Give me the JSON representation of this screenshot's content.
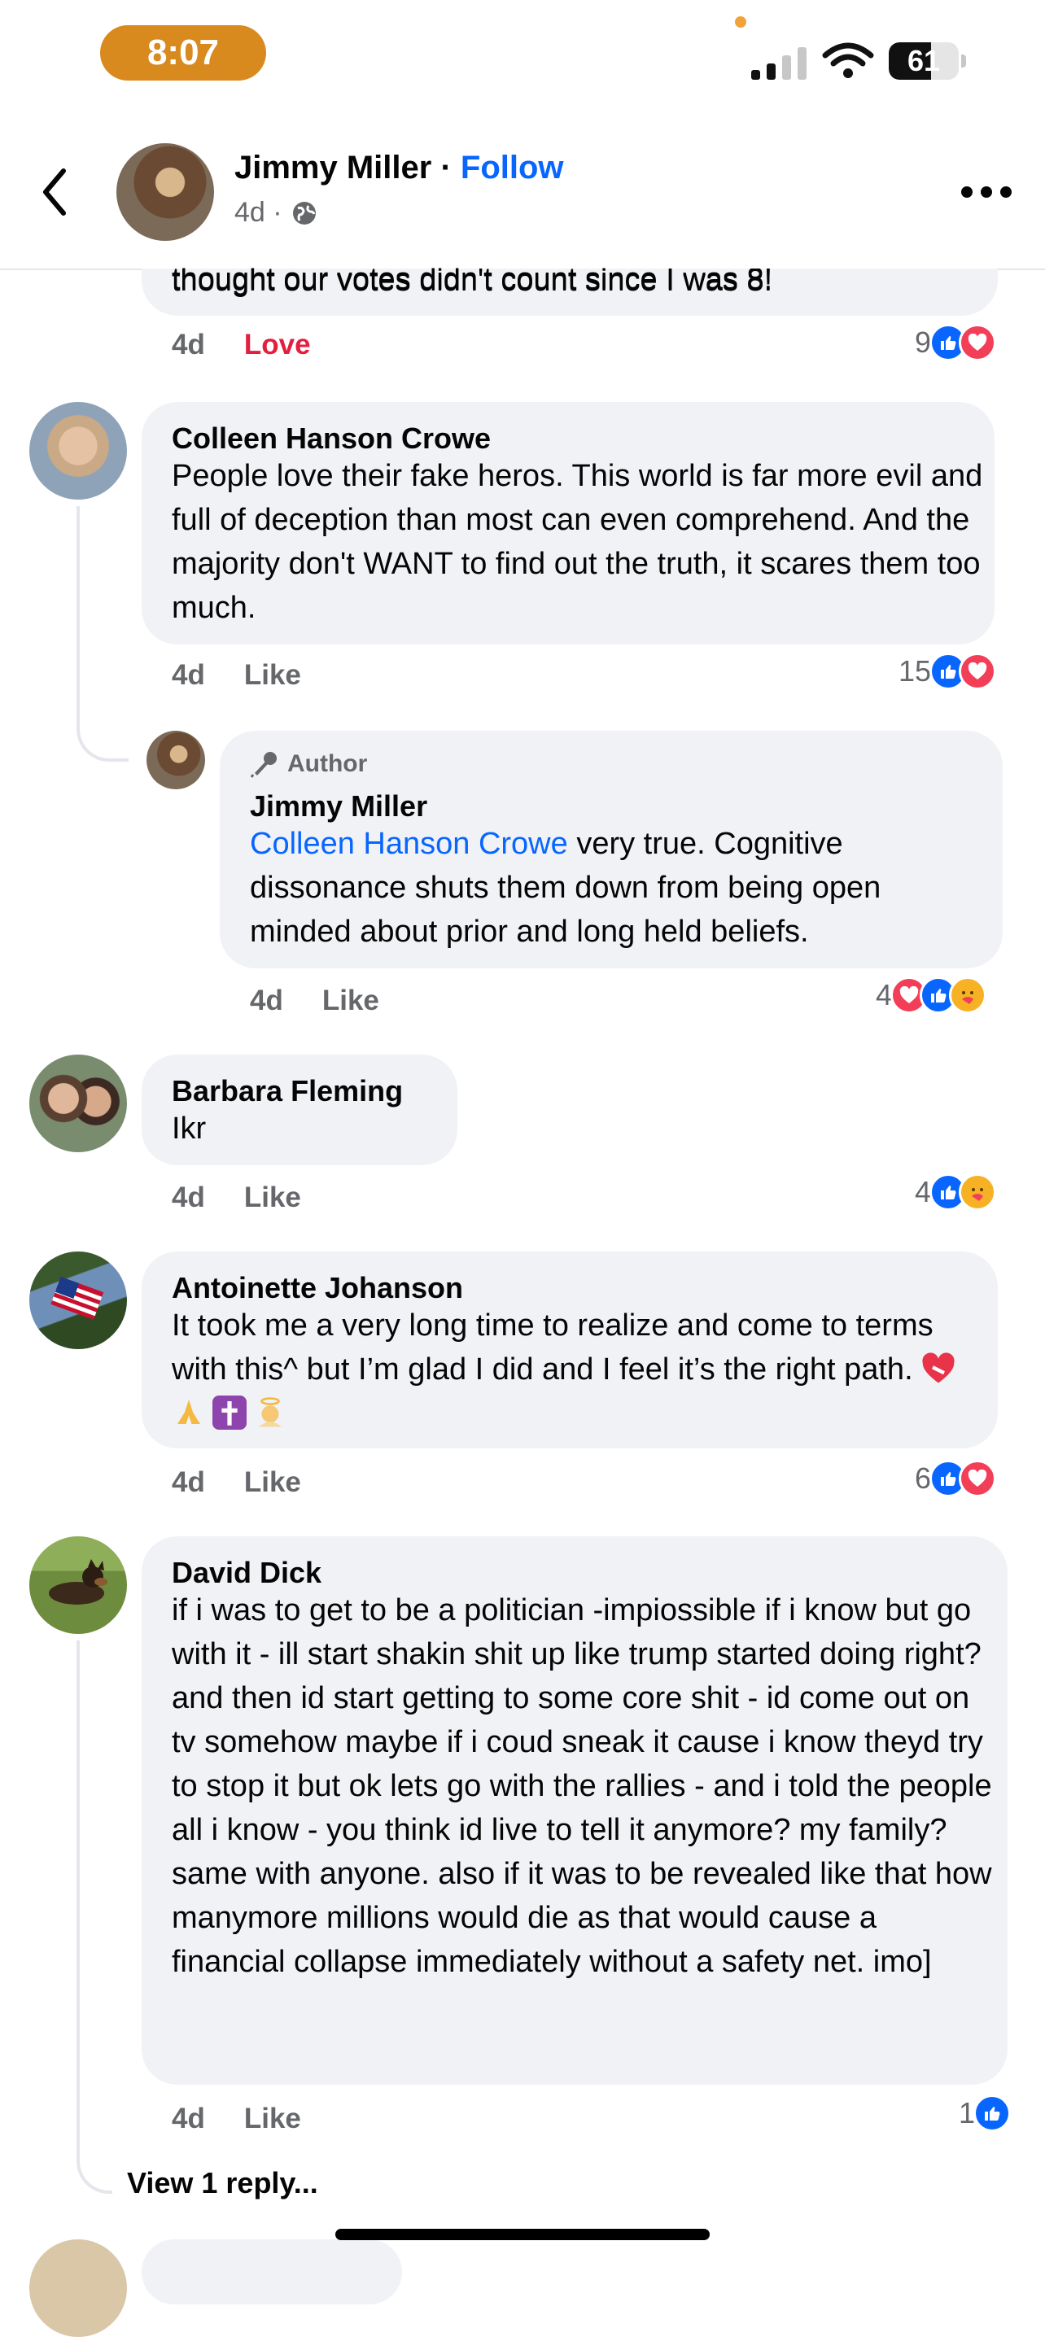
{
  "status_bar": {
    "time": "8:07",
    "battery": "61",
    "battery_level": 0.61
  },
  "header": {
    "name": "Jimmy Miller",
    "separator": "·",
    "follow": "Follow",
    "age": "4d ·"
  },
  "partial_comment": {
    "text": "thought our votes didn't count since I  was 8!",
    "time": "4d",
    "reaction_label": "Love",
    "reaction_count": "9"
  },
  "comments": [
    {
      "name": "Colleen Hanson Crowe",
      "text": "People love their fake heros. This world is far more evil and full of deception than most can even comprehend. And the majority don't WANT to find out the truth, it scares them too much.",
      "time": "4d",
      "like": "Like",
      "reaction_count": "15"
    },
    {
      "author_badge": "Author",
      "name": "Jimmy Miller",
      "mention": "Colleen Hanson Crowe",
      "text": " very true. Cognitive dissonance shuts them down from being open minded about prior and long held beliefs.",
      "time": "4d",
      "like": "Like",
      "reaction_count": "4"
    },
    {
      "name": "Barbara Fleming",
      "text": "Ikr",
      "time": "4d",
      "like": "Like",
      "reaction_count": "4"
    },
    {
      "name": "Antoinette Johanson",
      "text": "It took me a very long time to realize and come to terms with this^ but I’m glad I did and I feel it’s the right path. ",
      "time": "4d",
      "like": "Like",
      "reaction_count": "6"
    },
    {
      "name": "David Dick",
      "text": "if i was to get to be a politician -impiossible if i know but go with it - ill start shakin shit up like trump started doing right? and then id start getting to some core shit - id come out on tv somehow maybe if i coud sneak it cause i know theyd try to stop it but ok lets go with the rallies - and i told the people all i know - you think id live to tell it anymore? my family? same with anyone. also if it was to be revealed like that how manymore millions would die as that would cause a financial collapse immediately without a safety net. imo]",
      "time": "4d",
      "like": "Like",
      "reaction_count": "1"
    }
  ],
  "view_replies": "View 1 reply...",
  "colors": {
    "link": "#0866ff",
    "love": "#e41e3f",
    "bubble": "#f0f2f5",
    "meta": "#65676b"
  }
}
